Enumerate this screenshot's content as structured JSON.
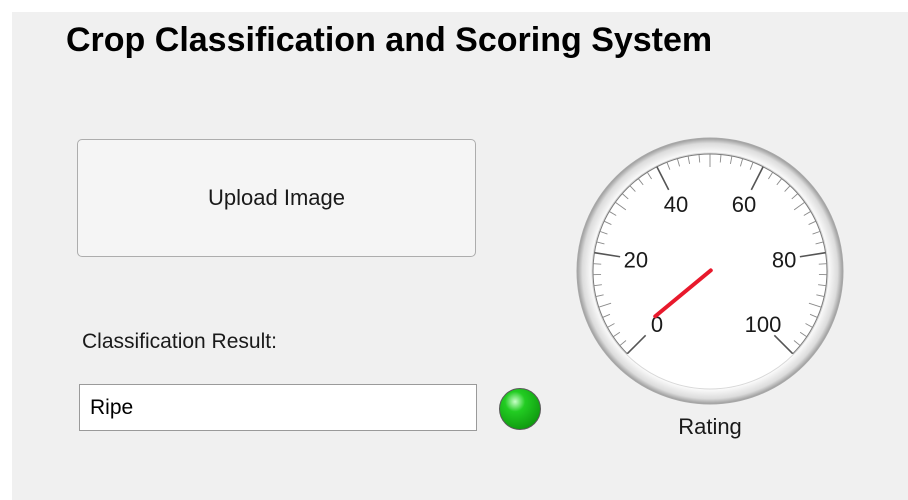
{
  "app": {
    "title": "Crop Classification and Scoring System"
  },
  "upload": {
    "label": "Upload Image"
  },
  "classification": {
    "label": "Classification Result:",
    "value": "Ripe",
    "lamp_color": "#22cc22"
  },
  "gauge": {
    "label": "Rating",
    "min": 0,
    "max": 100,
    "value": 2,
    "major_ticks": [
      "0",
      "20",
      "40",
      "60",
      "80",
      "100"
    ],
    "needle_color": "#e8192c"
  }
}
